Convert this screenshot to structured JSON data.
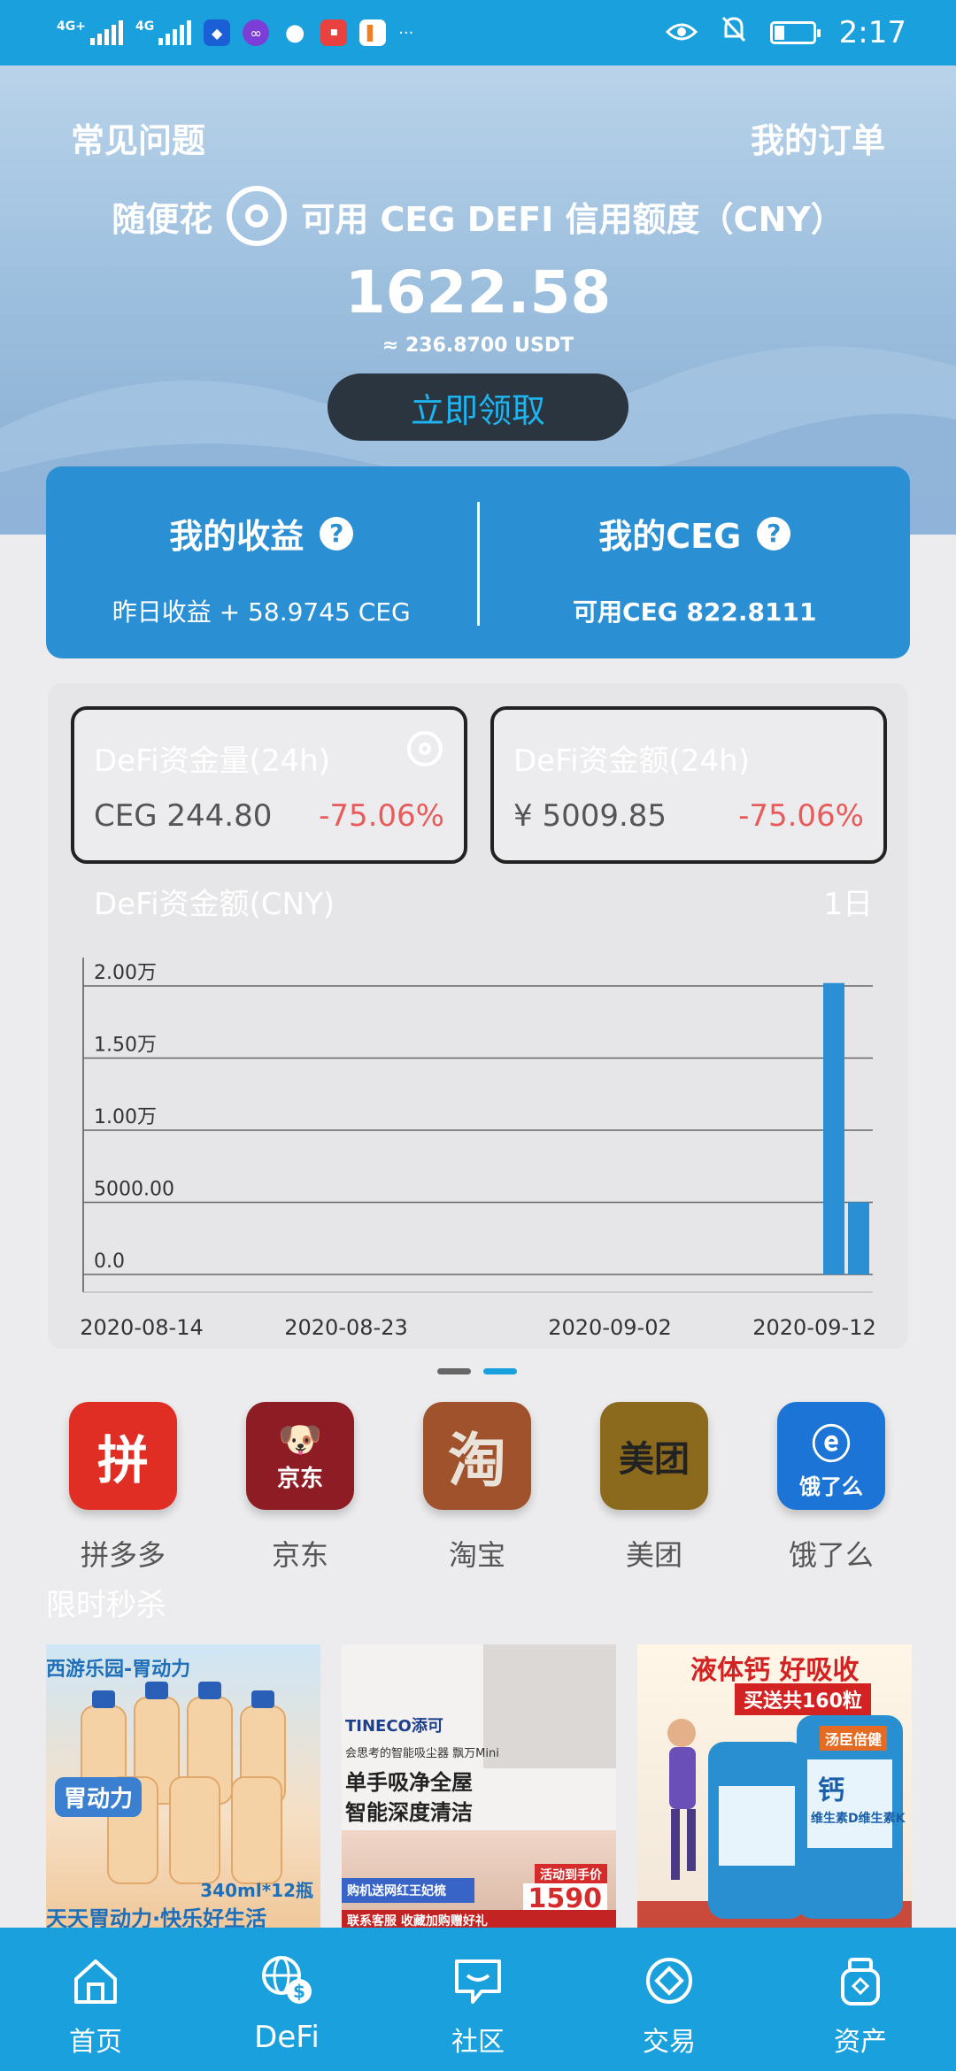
{
  "status_bar": {
    "signal1_label": "4G+",
    "signal2_label": "4G",
    "more_label": "···",
    "time": "2:17"
  },
  "hero": {
    "faq_label": "常见问题",
    "orders_label": "我的订单",
    "brand_label": "随便花",
    "credit_label": "可用 CEG DEFI 信用额度（CNY）",
    "credit_amount": "1622.58",
    "credit_usdt": "≈ 236.8700 USDT",
    "claim_button": "立即领取"
  },
  "earnings": {
    "income_title": "我的收益",
    "income_sub": "昨日收益 + 58.9745 CEG",
    "ceg_title": "我的CEG",
    "ceg_sub": "可用CEG 822.8111",
    "help_glyph": "?"
  },
  "stats": {
    "volume": {
      "title": "DeFi资金量(24h)",
      "value": "CEG 244.80",
      "change": "-75.06%"
    },
    "amount": {
      "title": "DeFi资金额(24h)",
      "value": "¥ 5009.85",
      "change": "-75.06%"
    }
  },
  "chart_data": {
    "type": "bar",
    "title": "DeFi资金额(CNY)",
    "range_label": "1日",
    "y_ticks": [
      "2.00万",
      "1.50万",
      "1.00万",
      "5000.00",
      "0.0"
    ],
    "x_ticks": [
      "2020-08-14",
      "2020-08-23",
      "2020-09-02",
      "2020-09-12"
    ],
    "ylim": [
      0,
      20000
    ],
    "x": [
      "2020-09-12",
      "2020-09-13"
    ],
    "values": [
      20200,
      5009.85
    ],
    "bar_color": "#2b8fd3",
    "grid": true
  },
  "shortcuts": [
    {
      "label": "拼多多",
      "glyph": "拼",
      "color": "#e02e24"
    },
    {
      "label": "京东",
      "glyph": "京东",
      "color": "#8d1c24"
    },
    {
      "label": "淘宝",
      "glyph": "淘",
      "color": "#a0522d"
    },
    {
      "label": "美团",
      "glyph": "美团",
      "color": "#8b6a1d"
    },
    {
      "label": "饿了么",
      "glyph": "饿了么",
      "color": "#1b74d6"
    }
  ],
  "flash_sale_title": "限时秒杀",
  "products": {
    "p1_top": "西游乐园-胃动力",
    "p1_mid": "胃动力",
    "p1_count": "340ml*12瓶",
    "p1_bottom": "天天胃动力·快乐好生活",
    "p2_brand": "TINECO添可",
    "p2_line1": "会思考的智能吸尘器 飘万Mini",
    "p2_headline1": "单手吸净全屋",
    "p2_headline2": "智能深度清洁",
    "p2_promo": "购机送网红王妃梳",
    "p2_price_label": "活动到手价",
    "p2_price": "1590",
    "p2_footer": "联系客服 收藏加购赠好礼",
    "p3_headline": "液体钙 好吸收",
    "p3_sub": "买送共160粒",
    "p3_brand": "汤臣倍健",
    "p3_label": "钙",
    "p3_desc": "维生素D维生素K"
  },
  "bottom_nav": [
    {
      "label": "首页"
    },
    {
      "label": "DeFi"
    },
    {
      "label": "社区"
    },
    {
      "label": "交易"
    },
    {
      "label": "资产"
    }
  ]
}
